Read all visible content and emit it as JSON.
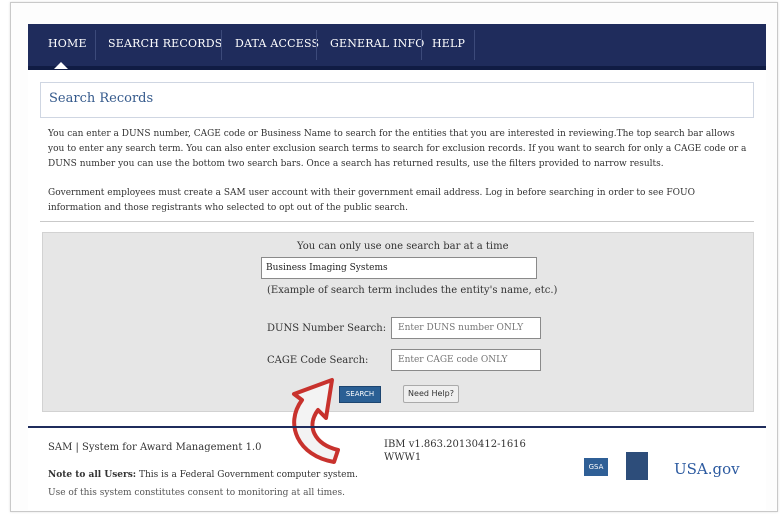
{
  "nav": {
    "items": [
      "HOME",
      "SEARCH RECORDS",
      "DATA ACCESS",
      "GENERAL INFO",
      "HELP"
    ],
    "active": "HOME"
  },
  "page": {
    "title": "Search Records",
    "intro": "You can enter a DUNS number, CAGE code or Business Name to search for the entities that you are interested in reviewing.The top search bar allows you to enter any search term. You can also enter exclusion search terms to search for exclusion records. If you want to search for only a CAGE code or a DUNS number you can use the bottom two search bars. Once a search has returned results, use the filters provided to narrow results.",
    "notice": "Government employees must create a SAM user account with their government email address. Log in before searching in order to see FOUO information and those registrants who selected to opt out of the public search."
  },
  "search": {
    "one_bar_note": "You can only use one search bar at a time",
    "main_value": "Business Imaging Systems",
    "example": "(Example of search term includes the entity's name, etc.)",
    "duns_label": "DUNS Number Search:",
    "duns_placeholder": "Enter DUNS number ONLY",
    "cage_label": "CAGE Code Search:",
    "cage_placeholder": "Enter CAGE code ONLY",
    "search_button": "SEARCH",
    "help_button": "Need Help?"
  },
  "footer": {
    "system": "SAM | System for Award Management 1.0",
    "version_line1": "IBM v1.863.20130412-1616",
    "version_line2": "WWW1",
    "note_label": "Note to all Users:",
    "note_text": " This is a Federal Government computer system.",
    "more_text": "Use of this system constitutes consent to monitoring at all times.",
    "gsa_logo": "GSA",
    "usa_logo": "USA.gov"
  },
  "colors": {
    "nav_bg": "#1f2c5c",
    "title": "#355a8c",
    "panel_bg": "#e6e6e6",
    "search_button": "#2a5f94",
    "arrow": "#c8322d"
  }
}
